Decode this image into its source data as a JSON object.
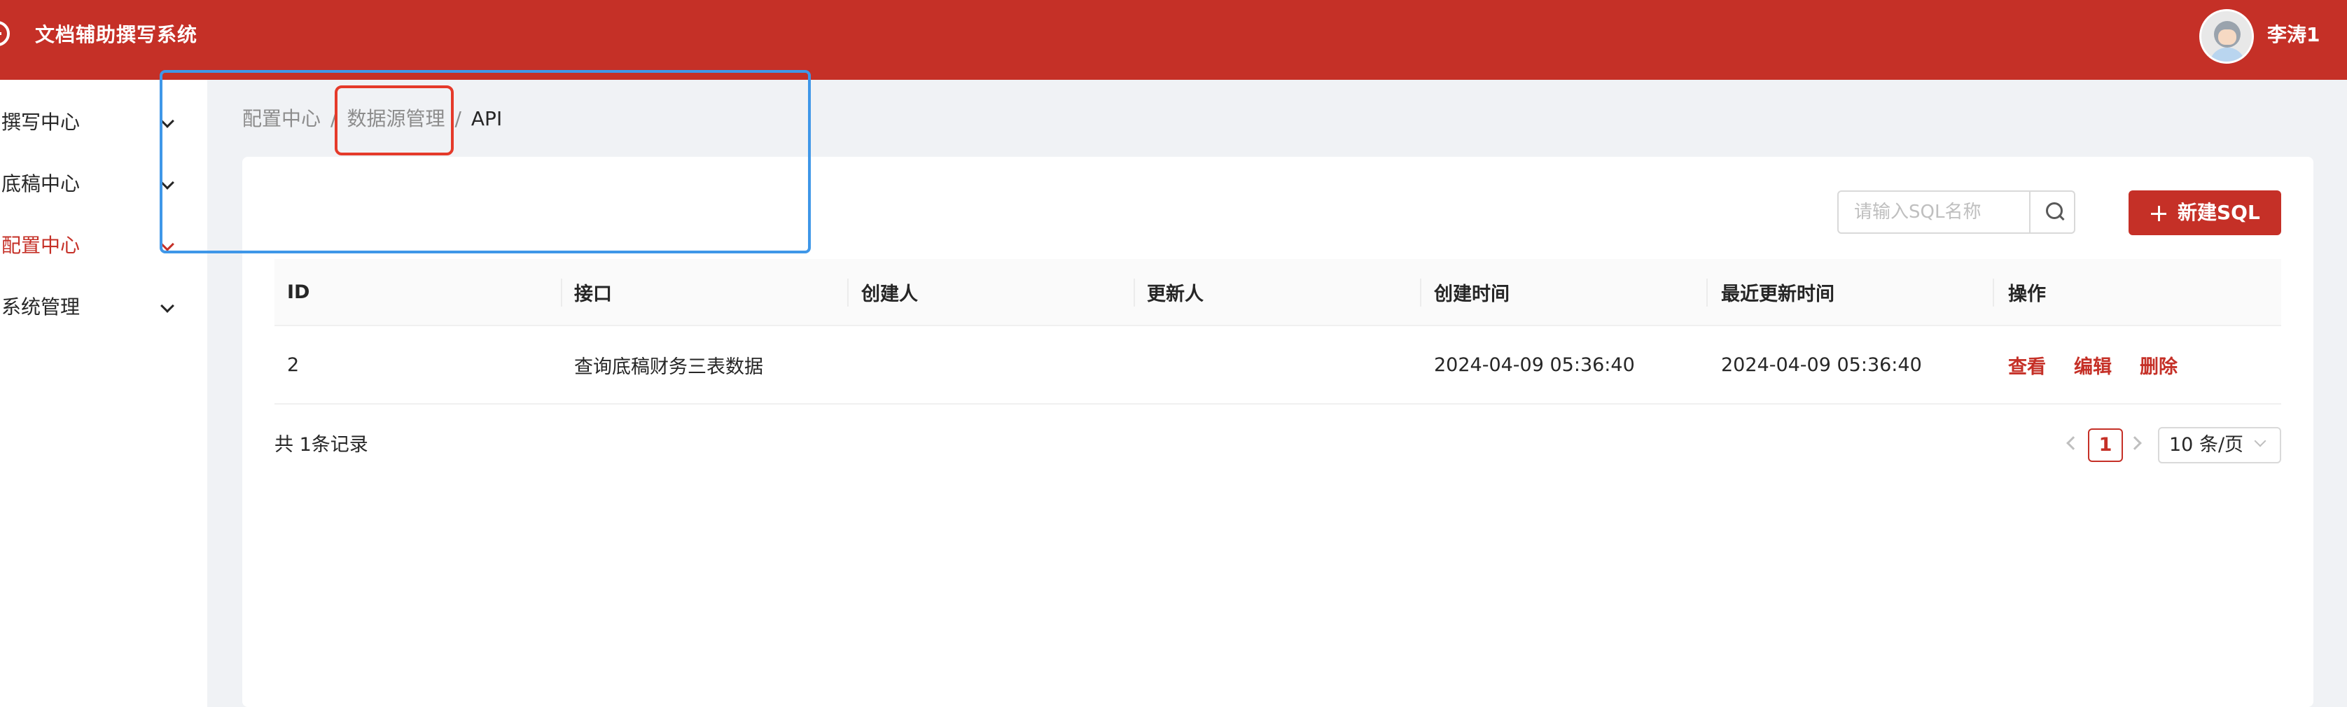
{
  "app": {
    "title": "文档辅助撰写系统",
    "user_name": "李涛1",
    "accent_color": "#c53027"
  },
  "sidebar": {
    "items": [
      {
        "label": "撰写中心",
        "active": false
      },
      {
        "label": "底稿中心",
        "active": false
      },
      {
        "label": "配置中心",
        "active": true
      },
      {
        "label": "系统管理",
        "active": false
      }
    ]
  },
  "breadcrumb": {
    "items": [
      "配置中心",
      "数据源管理",
      "API"
    ],
    "separator": "/"
  },
  "toolbar": {
    "search_placeholder": "请输入SQL名称",
    "search_icon": "search-icon",
    "new_button_label": "新建SQL"
  },
  "table": {
    "columns": [
      "ID",
      "接口",
      "创建人",
      "更新人",
      "创建时间",
      "最近更新时间",
      "操作"
    ],
    "rows": [
      {
        "id": "2",
        "api": "查询底稿财务三表数据",
        "creator": "",
        "updater": "",
        "created_at": "2024-04-09 05:36:40",
        "updated_at": "2024-04-09 05:36:40",
        "actions": [
          "查看",
          "编辑",
          "删除"
        ]
      }
    ]
  },
  "pagination": {
    "total_text": "共 1条记录",
    "current_page": "1",
    "page_size": "10 条/页"
  },
  "annotations": {
    "blue_box_color": "#3f97e8",
    "red_box_color": "#e53a2a"
  }
}
